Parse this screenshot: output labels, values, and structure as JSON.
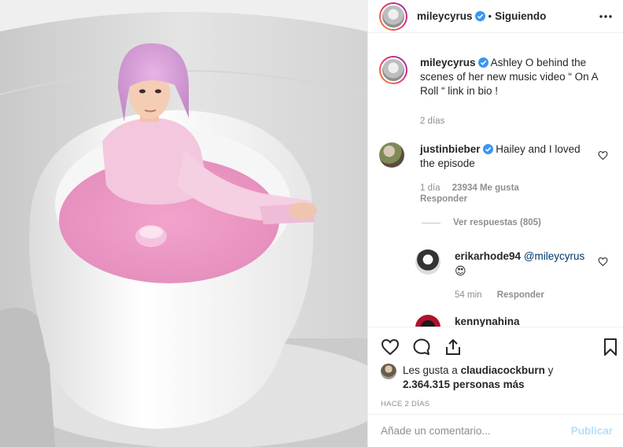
{
  "post": {
    "image_alt": "Woman with pink bob wig sitting in a white bathtub filled with pink liquid"
  },
  "header": {
    "username": "mileycyrus",
    "separator": "•",
    "follow_status": "Siguiendo",
    "more_icon": "more-dots-icon"
  },
  "caption": {
    "username": "mileycyrus",
    "text": "Ashley O behind the scenes of her new music video “ On A Roll “ link in bio !",
    "time": "2 días"
  },
  "comments": [
    {
      "username": "justinbieber",
      "text": "Hailey and I loved the episode",
      "time": "1 día",
      "likes": "23934 Me gusta",
      "reply_label": "Responder",
      "view_replies": "Ver respuestas (805)"
    }
  ],
  "replies": [
    {
      "username": "erikarhode94",
      "mention": "@mileycyrus",
      "emoji": "😍",
      "time": "54 min",
      "reply_label": "Responder"
    },
    {
      "username": "kennynahina"
    }
  ],
  "actions": {
    "like_icon": "heart-icon",
    "comment_icon": "comment-icon",
    "share_icon": "share-icon",
    "save_icon": "bookmark-icon"
  },
  "likes": {
    "prefix": "Les gusta a",
    "liker": "claudiacockburn",
    "conjunction": "y",
    "count": "2.364.315 personas más"
  },
  "post_age": "HACE 2 DÍAS",
  "add_comment": {
    "placeholder": "Añade un comentario...",
    "publish_label": "Publicar"
  },
  "colors": {
    "verified": "#3897f0",
    "link": "#003569",
    "publish_disabled": "#b2dffc",
    "muted": "#8e8e8e"
  }
}
